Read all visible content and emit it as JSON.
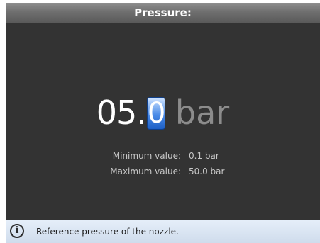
{
  "dialog": {
    "title": "Pressure:"
  },
  "value": {
    "digits_before_cursor": "05.",
    "cursor_digit": "0",
    "unit": "bar"
  },
  "limits": {
    "minimum_label": "Minimum value:",
    "minimum_value": "0.1 bar",
    "maximum_label": "Maximum value:",
    "maximum_value": "50.0 bar"
  },
  "info": {
    "icon": "info-icon",
    "icon_glyph": "i",
    "text": "Reference pressure of the nozzle."
  },
  "colors": {
    "background": "#333333",
    "cursor_accent": "#4a8be8",
    "info_bar": "#d8e4f2"
  }
}
